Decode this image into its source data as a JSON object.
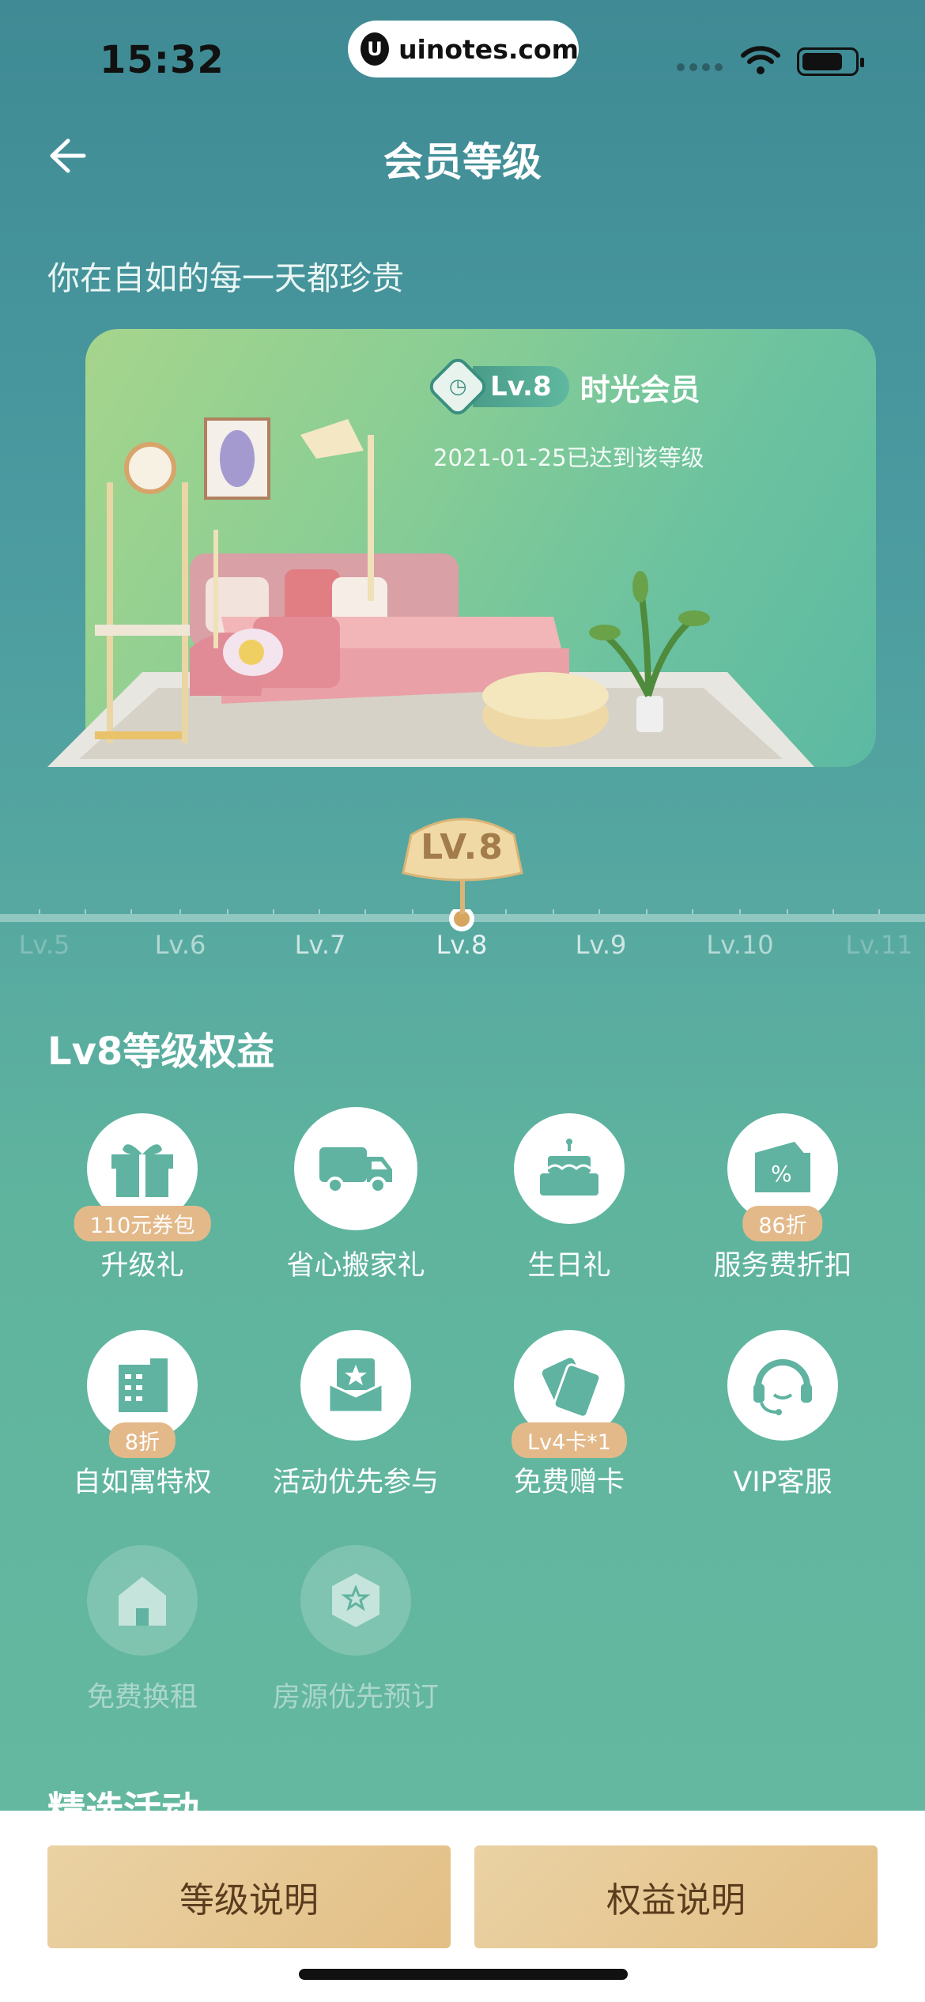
{
  "status": {
    "time": "15:32",
    "url": "uinotes.com"
  },
  "header": {
    "title": "会员等级"
  },
  "tagline": "你在自如的每一天都珍贵",
  "level_card": {
    "badge": "Lv.8",
    "name": "时光会员",
    "achieved": "2021-01-25已达到该等级"
  },
  "slider": {
    "current": "LV.8",
    "ticks": [
      "Lv.5",
      "Lv.6",
      "Lv.7",
      "Lv.8",
      "Lv.9",
      "Lv.10",
      "Lv.11"
    ]
  },
  "benefits": {
    "title": "Lv8等级权益",
    "items": [
      {
        "label": "升级礼",
        "tag": "110元券包",
        "icon": "gift-icon"
      },
      {
        "label": "省心搬家礼",
        "tag": "",
        "icon": "truck-icon"
      },
      {
        "label": "生日礼",
        "tag": "",
        "icon": "cake-icon"
      },
      {
        "label": "服务费折扣",
        "tag": "86折",
        "icon": "discount-tag-icon"
      },
      {
        "label": "自如寓特权",
        "tag": "8折",
        "icon": "building-icon"
      },
      {
        "label": "活动优先参与",
        "tag": "",
        "icon": "star-envelope-icon"
      },
      {
        "label": "免费赠卡",
        "tag": "Lv4卡*1",
        "icon": "card-icon"
      },
      {
        "label": "VIP客服",
        "tag": "",
        "icon": "headset-icon"
      },
      {
        "label": "免费换租",
        "tag": "",
        "icon": "house-swap-icon"
      },
      {
        "label": "房源优先预订",
        "tag": "",
        "icon": "star-hexagon-icon"
      }
    ]
  },
  "featured": {
    "title": "精选活动"
  },
  "buttons": {
    "level_info": "等级说明",
    "benefit_info": "权益说明"
  }
}
